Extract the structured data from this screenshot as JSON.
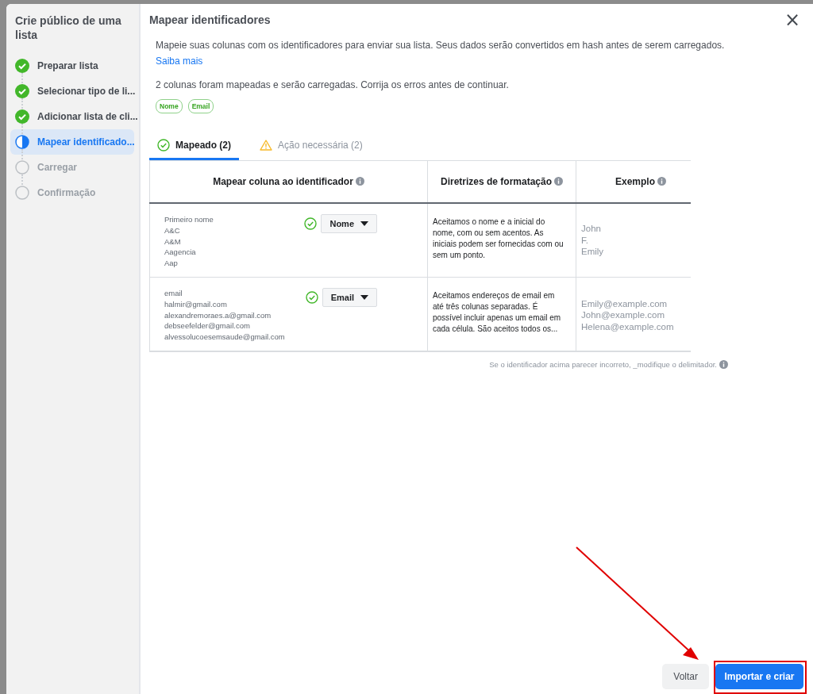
{
  "sidebar": {
    "title": "Crie público de uma lista",
    "steps": [
      {
        "label": "Preparar lista",
        "kind": "done",
        "selected": false
      },
      {
        "label": "Selecionar tipo de li...",
        "kind": "done",
        "selected": false
      },
      {
        "label": "Adicionar lista de cli...",
        "kind": "done",
        "selected": false
      },
      {
        "label": "Mapear identificado...",
        "kind": "current",
        "selected": true
      },
      {
        "label": "Carregar",
        "kind": "pending",
        "selected": false
      },
      {
        "label": "Confirmação",
        "kind": "pending",
        "selected": false
      }
    ]
  },
  "dialog": {
    "title": "Mapear identificadores",
    "close": "×",
    "intro": "Mapeie suas colunas com os identificadores para enviar sua lista. Seus dados serão convertidos em hash antes de serem carregados.",
    "learn_more": "Saiba mais",
    "summary": "2 colunas foram mapeadas e serão carregadas. Corrija os erros antes de continuar.",
    "tags": [
      "Nome",
      "Email"
    ],
    "tabs": [
      {
        "label": "Mapeado (2)",
        "kind": "check",
        "selected": true
      },
      {
        "label": "Ação necessária (2)",
        "kind": "warning",
        "selected": false
      }
    ],
    "table": {
      "columns": [
        "Mapear coluna ao identificador",
        "Diretrizes de formatação",
        "Exemplo"
      ],
      "rows": [
        {
          "values": [
            "Primeiro nome",
            "A&C",
            "A&M",
            "Aagencia",
            "Aap"
          ],
          "mapped": true,
          "identifier": "Nome",
          "guideline": "Aceitamos o nome e a inicial do nome, com ou sem acentos. As iniciais podem ser fornecidas com ou sem um ponto.",
          "examples": [
            "John",
            "F.",
            "Emily"
          ]
        },
        {
          "values": [
            "email",
            "halmir@gmail.com",
            "alexandremoraes.a@gmail.com",
            "debseefelder@gmail.com",
            "alvessolucoesemsaude@gmail.com"
          ],
          "mapped": true,
          "identifier": "Email",
          "guideline": "Aceitamos endereços de email em até três colunas separadas. É possível incluir apenas um email em cada célula. São aceitos todos os...",
          "examples": [
            "Emily@example.com",
            "John@example.com",
            "Helena@example.com"
          ]
        }
      ]
    },
    "note": "Se o identificador acima parecer incorreto, _modifique o delimitador.",
    "buttons": [
      {
        "label": "Voltar",
        "kind": "secondary"
      },
      {
        "label": "Importar e criar",
        "kind": "primary"
      }
    ]
  }
}
